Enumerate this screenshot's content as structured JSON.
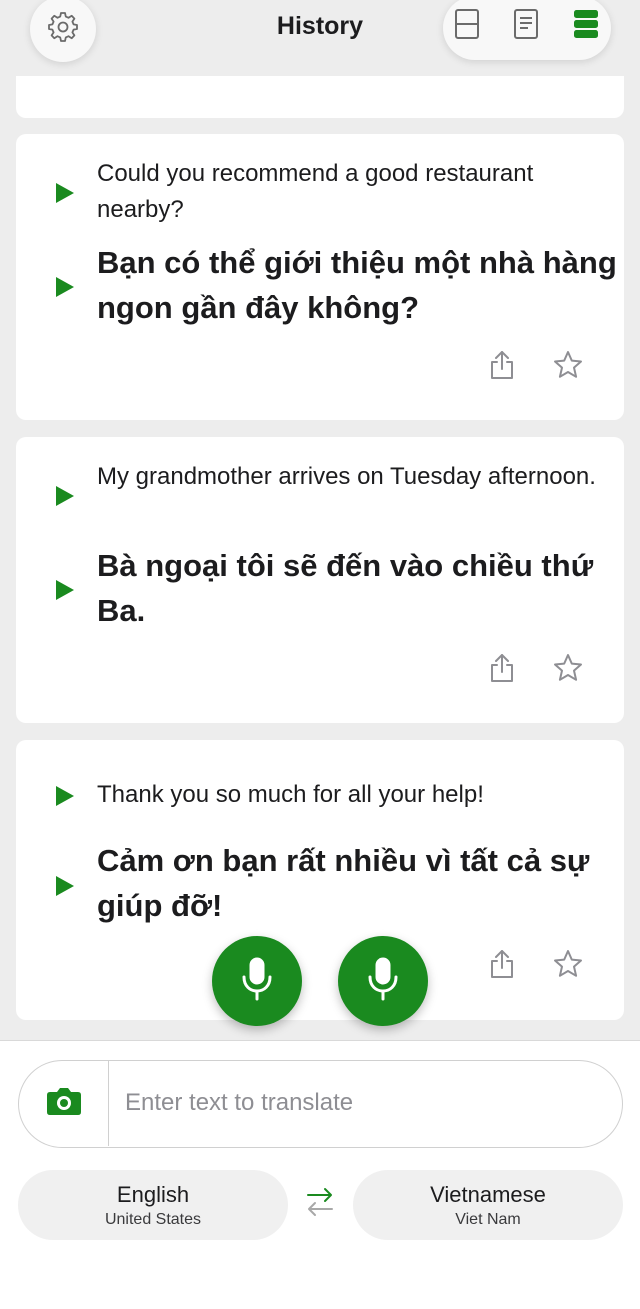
{
  "header": {
    "title": "History",
    "settings_icon": "gear-icon",
    "view_modes": [
      {
        "icon": "split-view-icon",
        "selected": false
      },
      {
        "icon": "document-view-icon",
        "selected": false
      },
      {
        "icon": "list-view-icon",
        "selected": true
      }
    ]
  },
  "history": [
    {
      "source": "Could you recommend a good restaurant nearby?",
      "translation": "Bạn có thể giới thiệu một nhà hàng ngon gần đây không?"
    },
    {
      "source": "My grandmother arrives on Tuesday afternoon.",
      "translation": "Bà ngoại tôi sẽ đến vào chiều thứ Ba."
    },
    {
      "source": "Thank you so much for all your help!",
      "translation": "Cảm ơn bạn rất nhiều vì tất cả sự giúp đỡ!"
    }
  ],
  "input": {
    "placeholder": "Enter text to translate",
    "value": ""
  },
  "languages": {
    "source": {
      "name": "English",
      "region": "United States"
    },
    "target": {
      "name": "Vietnamese",
      "region": "Viet Nam"
    }
  },
  "colors": {
    "accent": "#1a8a1f",
    "background": "#ededed",
    "card": "#ffffff"
  }
}
